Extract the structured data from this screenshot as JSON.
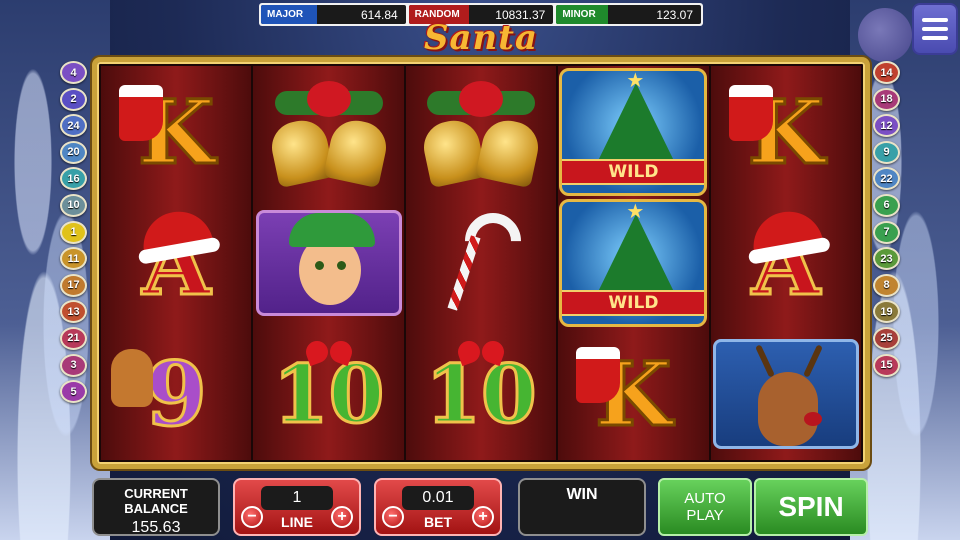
{
  "jackpots": {
    "major": {
      "label": "MAJOR",
      "value": "614.84"
    },
    "random": {
      "label": "RANDOM",
      "value": "10831.37"
    },
    "minor": {
      "label": "MINOR",
      "value": "123.07"
    }
  },
  "logo": "Santa",
  "paylines": {
    "left": [
      "4",
      "2",
      "24",
      "20",
      "16",
      "10",
      "1",
      "11",
      "17",
      "13",
      "21",
      "3",
      "5"
    ],
    "right": [
      "14",
      "18",
      "12",
      "9",
      "22",
      "6",
      "7",
      "23",
      "8",
      "19",
      "25",
      "15"
    ]
  },
  "reels": [
    [
      {
        "type": "letter",
        "letter": "K",
        "icon": "stocking-icon"
      },
      {
        "type": "letter",
        "letter": "A",
        "icon": "santa-hat-icon"
      },
      {
        "type": "letter",
        "letter": "9",
        "icon": "gingerbread-icon"
      }
    ],
    [
      {
        "type": "bells",
        "icon": "bells-icon"
      },
      {
        "type": "elf",
        "icon": "elf-icon"
      },
      {
        "type": "letter",
        "letter": "10",
        "icon": "bow-icon"
      }
    ],
    [
      {
        "type": "bells",
        "icon": "bells-icon"
      },
      {
        "type": "cane",
        "icon": "candy-cane-icon"
      },
      {
        "type": "letter",
        "letter": "10",
        "icon": "bow-icon"
      }
    ],
    [
      {
        "type": "wild",
        "label": "WILD",
        "icon": "christmas-tree-icon"
      },
      {
        "type": "wild",
        "label": "WILD",
        "icon": "christmas-tree-icon"
      },
      {
        "type": "letter",
        "letter": "K",
        "icon": "stocking-icon"
      }
    ],
    [
      {
        "type": "letter",
        "letter": "K",
        "icon": "stocking-icon"
      },
      {
        "type": "letter",
        "letter": "A",
        "icon": "santa-hat-icon"
      },
      {
        "type": "deer",
        "icon": "reindeer-icon"
      }
    ]
  ],
  "controls": {
    "balance_label": "CURRENT BALANCE",
    "balance_value": "155.63",
    "line_value": "1",
    "line_label": "LINE",
    "bet_value": "0.01",
    "bet_label": "BET",
    "win_label": "WIN",
    "win_value": "",
    "auto_line1": "AUTO",
    "auto_line2": "PLAY",
    "spin_label": "SPIN",
    "minus": "−",
    "plus": "+"
  },
  "colors": {
    "line_badges": [
      "#7b4fc4",
      "#5a4fc4",
      "#4f6fc4",
      "#4f86c4",
      "#38a0a8",
      "#6c8f9a",
      "#e0c21a",
      "#c9942a",
      "#c07a2f",
      "#c0502f",
      "#b83a5a",
      "#a83a78",
      "#9a3aa8"
    ],
    "line_badges_right": [
      "#c0402f",
      "#a83a78",
      "#7b4fc4",
      "#38a0a8",
      "#4f86c4",
      "#3aa04f",
      "#3aa04f",
      "#5a9a3a",
      "#c0842f",
      "#8a7a3a",
      "#a8403a",
      "#b83a5a"
    ]
  }
}
